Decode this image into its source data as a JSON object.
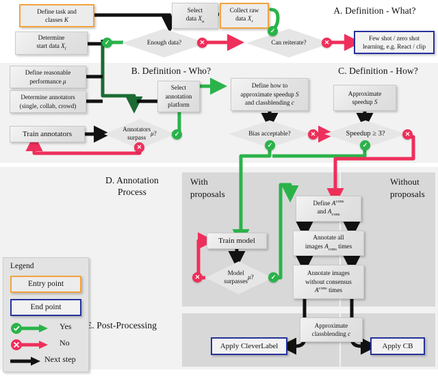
{
  "sections": {
    "a": {
      "title": "A. Definition - What?"
    },
    "b": {
      "title": "B. Definition - Who?"
    },
    "c": {
      "title": "C. Definition - How?"
    },
    "d": {
      "title_line1": "D. Annotation",
      "title_line2": "Process",
      "col_left_line1": "With",
      "col_left_line2": "proposals",
      "col_right_line1": "Without",
      "col_right_line2": "proposals"
    },
    "e": {
      "title": "E. Post-Processing"
    }
  },
  "nodes": {
    "define_task": {
      "label": "Define task and classes K",
      "type": "entry"
    },
    "determine_start": {
      "label": "Determine start data X_l",
      "type": "process"
    },
    "select_data": {
      "label": "Select data X_u",
      "type": "process"
    },
    "collect_raw": {
      "label": "Collect raw data X_r",
      "type": "entry"
    },
    "enough_data": {
      "label": "Enough data?",
      "type": "decision"
    },
    "can_reiterate": {
      "label": "Can reiterate?",
      "type": "decision"
    },
    "few_shot": {
      "label": "Few shot / zero shot learning, e.g. React / clip",
      "type": "end"
    },
    "define_perf": {
      "label": "Define reasonable performance μ",
      "type": "process"
    },
    "determine_annot": {
      "label": "Determine annotators (single, collab, crowd)",
      "type": "process"
    },
    "train_annotators": {
      "label": "Train annotators",
      "type": "process"
    },
    "select_platform": {
      "label": "Select annotation platform",
      "type": "process"
    },
    "annot_surpass": {
      "label": "Annotators surpass μ?",
      "type": "decision"
    },
    "define_how": {
      "label": "Define how to approximate speedup S and classblending c",
      "type": "process"
    },
    "approx_speedup": {
      "label": "Approximate speedup S",
      "type": "process"
    },
    "bias_acceptable": {
      "label": "Bias acceptable?",
      "type": "decision"
    },
    "speedup_ge3": {
      "label": "Speedup ≥ 3?",
      "type": "decision"
    },
    "train_model": {
      "label": "Train model",
      "type": "process"
    },
    "model_surpass": {
      "label": "Model surpasses μ?",
      "type": "decision"
    },
    "define_acons": {
      "label": "Define A^cons and A_cons",
      "type": "process"
    },
    "annotate_all": {
      "label": "Annotate all images A_cons times",
      "type": "process"
    },
    "annotate_without": {
      "label": "Annotate images without consensus A^cons times",
      "type": "process"
    },
    "approx_cb": {
      "label": "Approximate classblending c",
      "type": "process"
    },
    "apply_cleverlabel": {
      "label": "Apply CleverLabel",
      "type": "end"
    },
    "apply_cb": {
      "label": "Apply CB",
      "type": "end"
    }
  },
  "legend": {
    "title": "Legend",
    "entry_point": "Entry point",
    "end_point": "End point",
    "yes": "Yes",
    "no": "No",
    "next_step": "Next step"
  },
  "colors": {
    "yes_green": "#2ab34a",
    "dark_green": "#1b6b33",
    "no_red": "#ef2f5b",
    "next_black": "#121212",
    "entry_orange": "#f2a33c",
    "end_blue": "#26319b",
    "panel_light": "#f2f2f2",
    "panel_dark": "#d8d8d8",
    "box_fill": "#e6e6e6"
  },
  "icons": {
    "yes_badge": "check-circle-icon",
    "no_badge": "cross-circle-icon",
    "arrow": "arrow-icon"
  }
}
